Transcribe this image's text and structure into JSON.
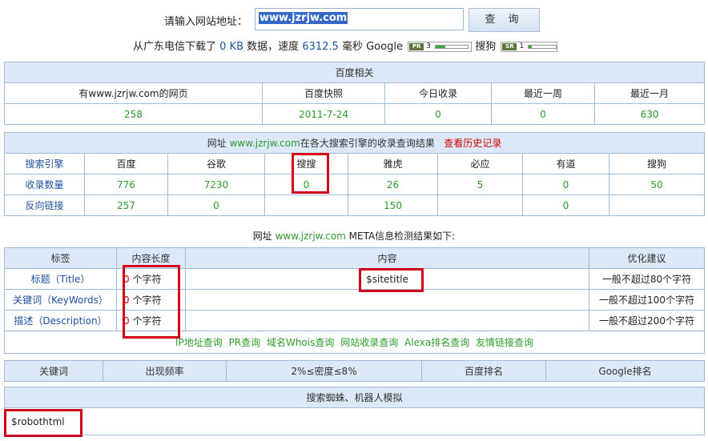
{
  "search": {
    "label": "请输入网站地址：",
    "value": "www.jzrjw.com",
    "button": "查 询"
  },
  "stats": {
    "prefix": "从广东电信下载了",
    "size": "0 KB",
    "mid1": "数据，速度",
    "speed": "6312.5",
    "mid2": "毫秒",
    "google_label": "Google",
    "pr_tag": "PR",
    "pr_value": "3",
    "pr_level": 0.3,
    "sogou_label": "搜狗",
    "sr_tag": "SR",
    "sr_value": "1",
    "sr_level": 0.1
  },
  "baidu": {
    "title": "百度相关",
    "headers": [
      "有www.jzrjw.com的网页",
      "百度快照",
      "今日收录",
      "最近一周",
      "最近一月"
    ],
    "values": [
      "258",
      "2011-7-24",
      "0",
      "0",
      "630"
    ]
  },
  "engines": {
    "title_prefix": "网址",
    "title_domain": "www.jzrjw.com",
    "title_suffix": "在各大搜索引擎的收录查询结果",
    "history_link": "查看历史记录",
    "row_labels": [
      "搜索引擎",
      "收录数量",
      "反向链接"
    ],
    "names": [
      "百度",
      "谷歌",
      "搜搜",
      "雅虎",
      "必应",
      "有道",
      "搜狗"
    ],
    "counts": [
      "776",
      "7230",
      "0",
      "26",
      "5",
      "0",
      "50"
    ],
    "backlinks": [
      "257",
      "0",
      "",
      "150",
      "",
      "0",
      ""
    ]
  },
  "meta": {
    "title_prefix": "网址",
    "title_domain": "www.jzrjw.com",
    "title_suffix": "META信息检测结果如下:",
    "headers": [
      "标签",
      "内容长度",
      "内容",
      "优化建议"
    ],
    "rows": [
      {
        "tag": "标题（Title）",
        "len": "0",
        "unit": "个字符",
        "content": "$sitetitle",
        "advice": "一般不超过80个字符"
      },
      {
        "tag": "关键词（KeyWords）",
        "len": "0",
        "unit": "个字符",
        "content": "",
        "advice": "一般不超过100个字符"
      },
      {
        "tag": "描述（Description）",
        "len": "0",
        "unit": "个字符",
        "content": "",
        "advice": "一般不超过200个字符"
      }
    ],
    "tools": [
      "IP地址查询",
      "PR查询",
      "域名Whois查询",
      "网站收录查询",
      "Alexa排名查询",
      "友情链接查询"
    ]
  },
  "keywords": {
    "headers": [
      "关键词",
      "出现频率",
      "2%≤密度≤8%",
      "百度排名",
      "Google排名"
    ]
  },
  "spider": {
    "title": "搜索蜘蛛、机器人模拟",
    "content": "$robothtml"
  },
  "colors": {
    "header_bg": "#dce8f6",
    "border": "#9fbbd8",
    "value_green": "#2e9a2e",
    "link_blue": "#1d4f9c",
    "highlight_red": "#d0021b"
  }
}
